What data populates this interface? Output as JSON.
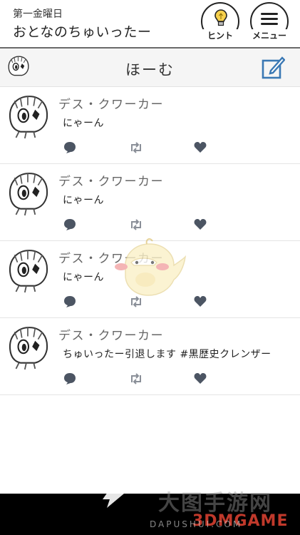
{
  "header": {
    "subtitle": "第一金曜日",
    "title": "おとなのちゅいったー",
    "hint_label": "ヒント",
    "menu_label": "メニュー"
  },
  "homebar": {
    "title": "ほーむ"
  },
  "posts": [
    {
      "username": "デス・クワーカー",
      "message": "にゃーん"
    },
    {
      "username": "デス・クワーカー",
      "message": "にゃーん"
    },
    {
      "username": "デス・クワーカー",
      "message": "にゃーん"
    },
    {
      "username": "デス・クワーカー",
      "message": "ちゅいったー引退します #黒歴史クレンザー"
    }
  ],
  "icons": {
    "reply": "speech-bubble-icon",
    "retweet": "retweet-icon",
    "like": "heart-icon",
    "compose": "compose-icon",
    "hint": "lightbulb-icon",
    "menu": "hamburger-menu-icon"
  },
  "colors": {
    "action_icon": "#4c5563",
    "header_bar": "#f5f5f5",
    "compose_icon": "#3a78b4"
  },
  "watermark": {
    "cn": "大图手游网",
    "brand": "3DMGAME",
    "url": "DAPUSHUI.COM"
  }
}
